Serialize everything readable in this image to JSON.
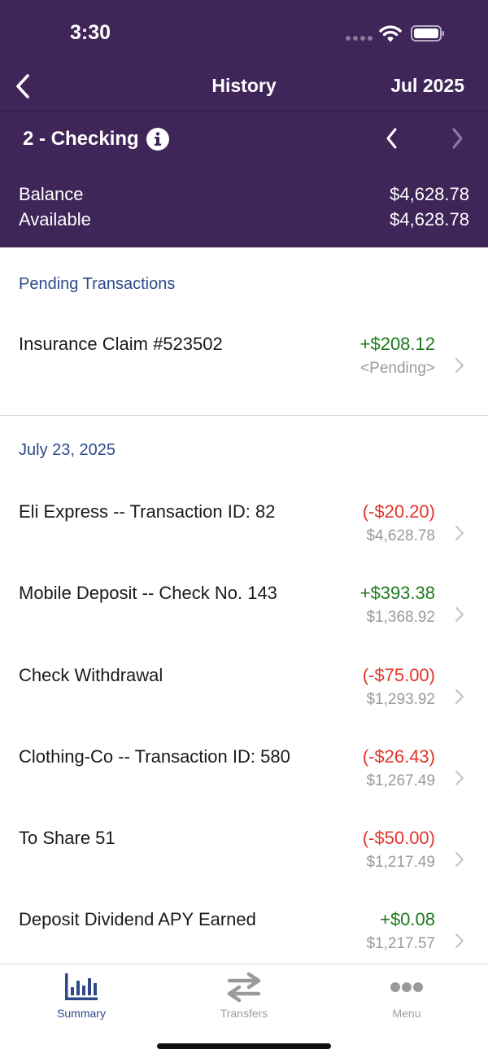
{
  "status_bar": {
    "time": "3:30"
  },
  "nav": {
    "title": "History",
    "month": "Jul 2025"
  },
  "account": {
    "name": "2 - Checking",
    "balance_label": "Balance",
    "balance_value": "$4,628.78",
    "available_label": "Available",
    "available_value": "$4,628.78"
  },
  "pending": {
    "header": "Pending Transactions",
    "items": [
      {
        "description": "Insurance Claim #523502",
        "amount": "+$208.12",
        "sub": "<Pending>",
        "direction": "credit"
      }
    ]
  },
  "posted": {
    "header": "July 23, 2025",
    "items": [
      {
        "description": "Eli Express -- Transaction ID: 82",
        "amount": "(-$20.20)",
        "balance": "$4,628.78",
        "direction": "debit"
      },
      {
        "description": "Mobile Deposit -- Check No. 143",
        "amount": "+$393.38",
        "balance": "$1,368.92",
        "direction": "credit"
      },
      {
        "description": "Check Withdrawal",
        "amount": "(-$75.00)",
        "balance": "$1,293.92",
        "direction": "debit"
      },
      {
        "description": "Clothing-Co -- Transaction ID: 580",
        "amount": "(-$26.43)",
        "balance": "$1,267.49",
        "direction": "debit"
      },
      {
        "description": "To Share 51",
        "amount": "(-$50.00)",
        "balance": "$1,217.49",
        "direction": "debit"
      },
      {
        "description": "Deposit Dividend APY Earned",
        "amount": "+$0.08",
        "balance": "$1,217.57",
        "direction": "credit"
      }
    ]
  },
  "tabbar": {
    "tabs": [
      {
        "label": "Summary",
        "icon": "bar-chart-icon",
        "active": true
      },
      {
        "label": "Transfers",
        "icon": "transfer-arrows-icon",
        "active": false
      },
      {
        "label": "Menu",
        "icon": "more-dots-icon",
        "active": false
      }
    ]
  },
  "colors": {
    "header_bg": "#3f2558",
    "accent_blue": "#2d4a8a",
    "credit_green": "#1d7a1d",
    "debit_red": "#e2342a"
  }
}
